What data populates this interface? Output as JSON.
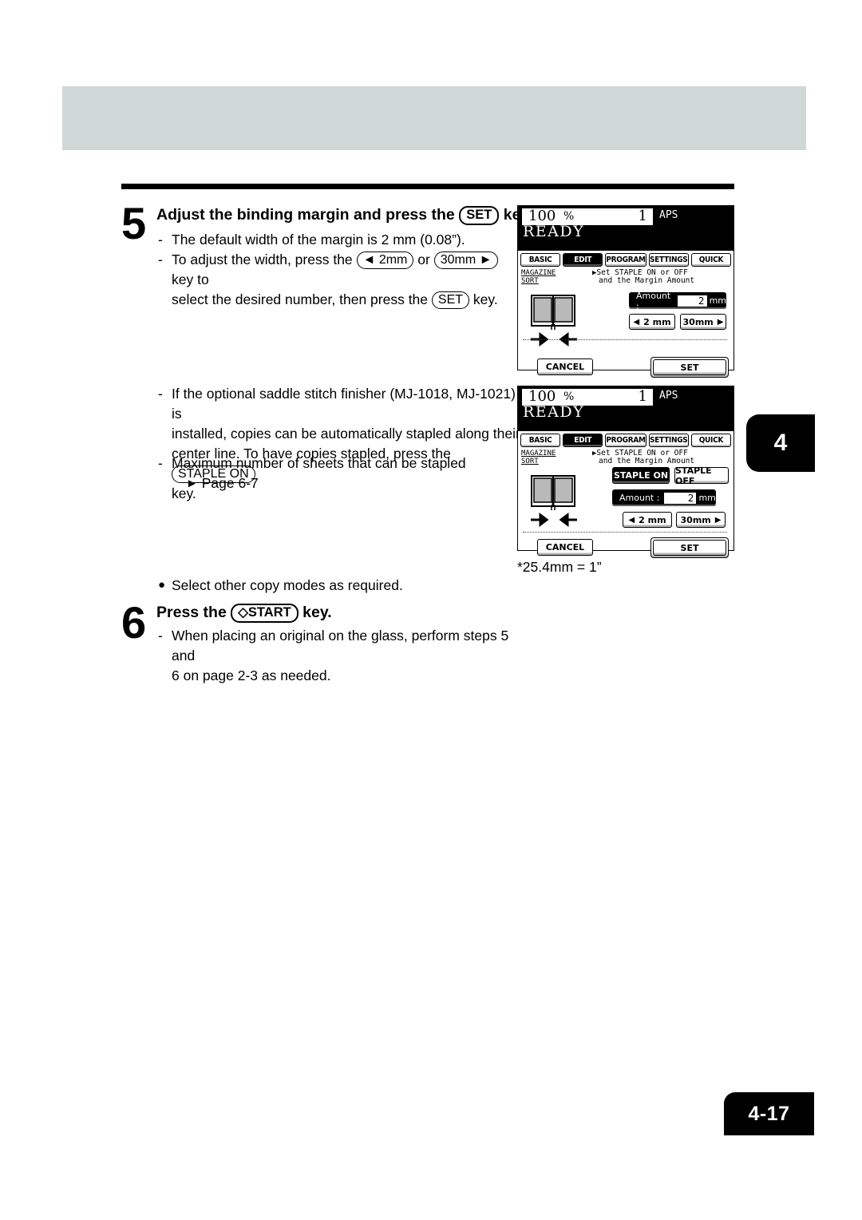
{
  "page": {
    "chapter_tab": "4",
    "page_number": "4-17"
  },
  "steps": [
    {
      "number": "5",
      "heading_before": "Adjust the binding margin and press the",
      "heading_key": "SET",
      "heading_after": "key.",
      "lines": [
        "The default width of the margin is 2 mm (0.08”)."
      ],
      "line2_a": "To adjust the width, press the",
      "line2_key1": "◄ 2mm",
      "line2_b": "or",
      "line2_key2": "30mm ►",
      "line2_c": "key to",
      "line2_d": "select the desired number, then press the",
      "line2_key3": "SET",
      "line2_e": "key."
    },
    {
      "number": "6",
      "heading_before": "Press the",
      "heading_key": "◇START",
      "heading_after": "key.",
      "lines": [
        "When placing an original on the glass, perform steps 5 and",
        "6 on page 2-3 as needed."
      ]
    }
  ],
  "note": {
    "line1_a": "If the optional saddle stitch finisher (MJ-1018, MJ-1021) is",
    "line1_b": "installed, copies can be automatically stapled along their",
    "line1_c": "center line. To have copies stapled, press the",
    "line1_key": "STAPLE ON",
    "line1_d": "key.",
    "line2_a": "Maximum number of sheets that can be stapled",
    "line2_b": "Page 6-7",
    "arrow": "►"
  },
  "bullet": {
    "marker": "●",
    "text": "Select other copy modes as required."
  },
  "footnote": "*25.4mm = 1”",
  "lcd": {
    "status": {
      "ratio": "100",
      "percent": "%",
      "copies": "1",
      "paper_mode": "APS",
      "state": "READY"
    },
    "tabs": [
      {
        "label": "BASIC",
        "active": false
      },
      {
        "label": "EDIT",
        "active": true
      },
      {
        "label": "PROGRAM",
        "active": false
      },
      {
        "label": "SETTINGS",
        "active": false
      },
      {
        "label": "QUICK",
        "active": false
      }
    ],
    "mode_label_1": "MAGAZINE",
    "mode_label_2": "SORT",
    "prompt_marker": "▶",
    "prompt_line1": "Set STAPLE ON or OFF",
    "prompt_line2": "and the Margin Amount",
    "amount": {
      "label": "Amount :",
      "value": "2",
      "unit": "mm"
    },
    "dec_button": "2 mm",
    "inc_button": "30mm",
    "dec_arrow": "◀",
    "inc_arrow": "▶",
    "staple_on": "STAPLE ON",
    "staple_off": "STAPLE OFF",
    "cancel": "CANCEL",
    "set": "SET"
  }
}
